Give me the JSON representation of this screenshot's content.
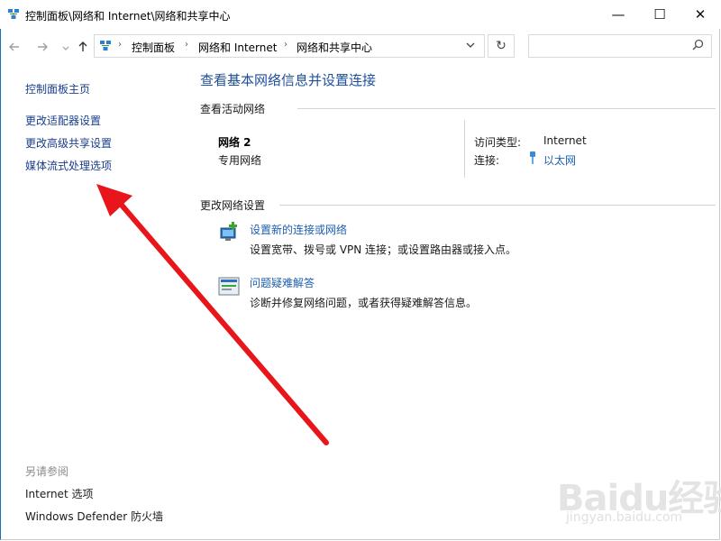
{
  "window": {
    "title": "控制面板\\网络和 Internet\\网络和共享中心",
    "controls": {
      "minimize": "—",
      "maximize": "☐",
      "close": "✕"
    }
  },
  "nav": {
    "back_icon": "arrow-left-icon",
    "forward_icon": "arrow-right-icon",
    "up_icon": "arrow-up-icon",
    "breadcrumb": [
      "控制面板",
      "网络和 Internet",
      "网络和共享中心"
    ],
    "refresh_icon": "refresh-icon",
    "search_placeholder": ""
  },
  "sidebar": {
    "home": "控制面板主页",
    "links": [
      "更改适配器设置",
      "更改高级共享设置",
      "媒体流式处理选项"
    ],
    "see_also_heading": "另请参阅",
    "see_also": [
      "Internet 选项",
      "Windows Defender 防火墙"
    ]
  },
  "main": {
    "title": "查看基本网络信息并设置连接",
    "active_heading": "查看活动网络",
    "network": {
      "name": "网络 2",
      "category": "专用网络",
      "access_label": "访问类型:",
      "access_value": "Internet",
      "connection_label": "连接:",
      "connection_value": "以太网"
    },
    "change_heading": "更改网络设置",
    "tasks": [
      {
        "title": "设置新的连接或网络",
        "desc": "设置宽带、拨号或 VPN 连接；或设置路由器或接入点。",
        "icon": "new-connection-icon"
      },
      {
        "title": "问题疑难解答",
        "desc": "诊断并修复网络问题，或者获得疑难解答信息。",
        "icon": "troubleshoot-icon"
      }
    ]
  },
  "annotation": {
    "color": "#e8161b"
  },
  "watermark": {
    "main": "Baidu经验",
    "sub": "jingyan.baidu.com"
  },
  "colors": {
    "link": "#1e5fb0",
    "title": "#1e4f9e",
    "frame": "#1f6fb4"
  }
}
